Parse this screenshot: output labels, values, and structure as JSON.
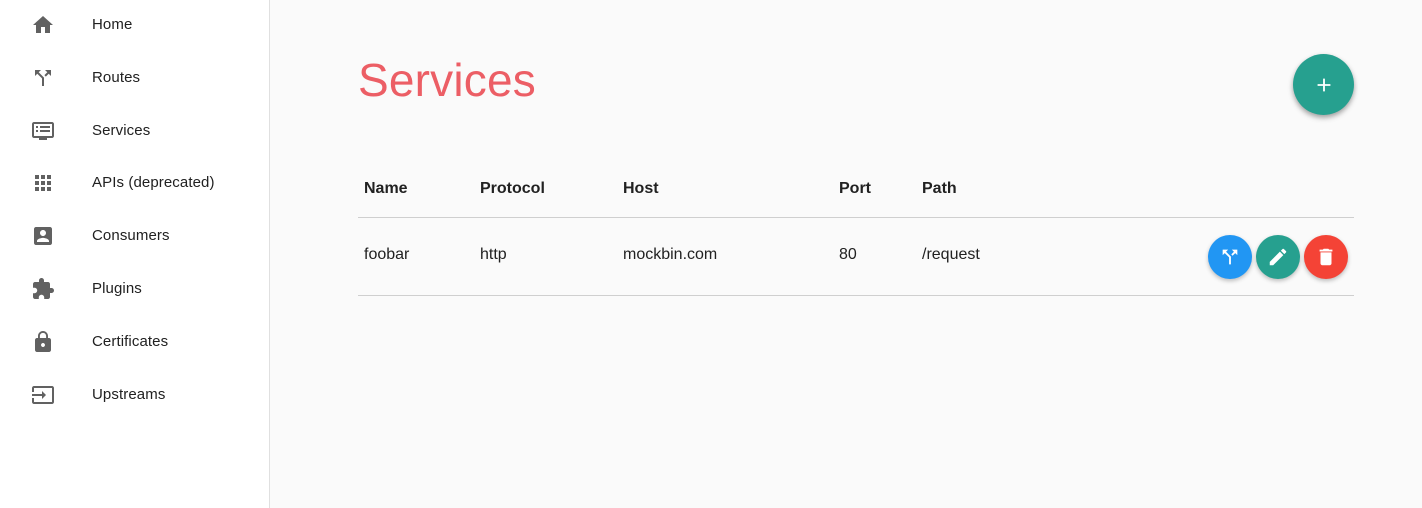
{
  "sidebar": {
    "items": [
      {
        "label": "Home",
        "icon": "home-icon"
      },
      {
        "label": "Routes",
        "icon": "call-split-icon"
      },
      {
        "label": "Services",
        "icon": "monitor-list-icon"
      },
      {
        "label": "APIs (deprecated)",
        "icon": "apps-grid-icon"
      },
      {
        "label": "Consumers",
        "icon": "account-box-icon"
      },
      {
        "label": "Plugins",
        "icon": "extension-puzzle-icon"
      },
      {
        "label": "Certificates",
        "icon": "lock-icon"
      },
      {
        "label": "Upstreams",
        "icon": "input-arrow-icon"
      }
    ]
  },
  "main": {
    "title": "Services",
    "add_button_icon": "plus-icon"
  },
  "table": {
    "columns": [
      "Name",
      "Protocol",
      "Host",
      "Port",
      "Path"
    ],
    "rows": [
      {
        "name": "foobar",
        "protocol": "http",
        "host": "mockbin.com",
        "port": "80",
        "path": "/request",
        "actions": [
          {
            "icon": "call-split-icon",
            "color": "#2196f3"
          },
          {
            "icon": "edit-pencil-icon",
            "color": "#26a08f"
          },
          {
            "icon": "delete-trash-icon",
            "color": "#f44336"
          }
        ]
      }
    ]
  },
  "colors": {
    "accent_title": "#ec5e65",
    "fab": "#26a08f",
    "routes_button": "#2196f3",
    "edit_button": "#26a08f",
    "delete_button": "#f44336"
  }
}
